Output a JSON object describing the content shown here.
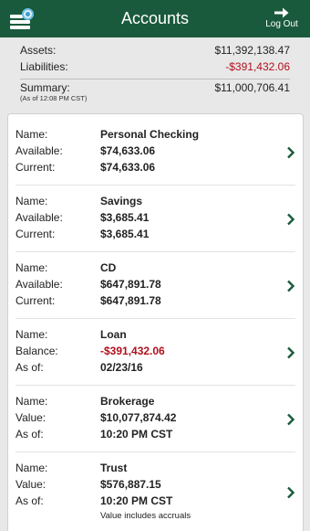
{
  "header": {
    "title": "Accounts",
    "logout_label": "Log Out"
  },
  "summary": {
    "assets_label": "Assets:",
    "assets_value": "$11,392,138.47",
    "liabilities_label": "Liabilities:",
    "liabilities_value": "-$391,432.06",
    "summary_label": "Summary:",
    "summary_value": "$11,000,706.41",
    "as_of": "(As of 12:08 PM CST)"
  },
  "accounts": [
    {
      "rows": [
        {
          "label": "Name:",
          "value": "Personal Checking"
        },
        {
          "label": "Available:",
          "value": "$74,633.06"
        },
        {
          "label": "Current:",
          "value": "$74,633.06"
        }
      ]
    },
    {
      "rows": [
        {
          "label": "Name:",
          "value": "Savings"
        },
        {
          "label": "Available:",
          "value": "$3,685.41"
        },
        {
          "label": "Current:",
          "value": "$3,685.41"
        }
      ]
    },
    {
      "rows": [
        {
          "label": "Name:",
          "value": "CD"
        },
        {
          "label": "Available:",
          "value": "$647,891.78"
        },
        {
          "label": "Current:",
          "value": "$647,891.78"
        }
      ]
    },
    {
      "rows": [
        {
          "label": "Name:",
          "value": "Loan"
        },
        {
          "label": "Balance:",
          "value": "-$391,432.06"
        },
        {
          "label": "As of:",
          "value": "02/23/16"
        }
      ]
    },
    {
      "rows": [
        {
          "label": "Name:",
          "value": "Brokerage"
        },
        {
          "label": "Value:",
          "value": "$10,077,874.42"
        },
        {
          "label": "As of:",
          "value": "10:20 PM CST"
        }
      ]
    },
    {
      "rows": [
        {
          "label": "Name:",
          "value": "Trust"
        },
        {
          "label": "Value:",
          "value": "$576,887.15"
        },
        {
          "label": "As of:",
          "value": "10:20 PM CST"
        }
      ],
      "note": "Value includes accruals"
    }
  ],
  "colors": {
    "header": "#1a5a3c",
    "negative": "#b0101d",
    "chevron": "#1a5a3c"
  },
  "icons": {
    "menu": "hamburger-menu-icon",
    "badge": "notification-badge-icon",
    "logout": "arrow-right-icon",
    "chevron": "chevron-right-icon"
  }
}
